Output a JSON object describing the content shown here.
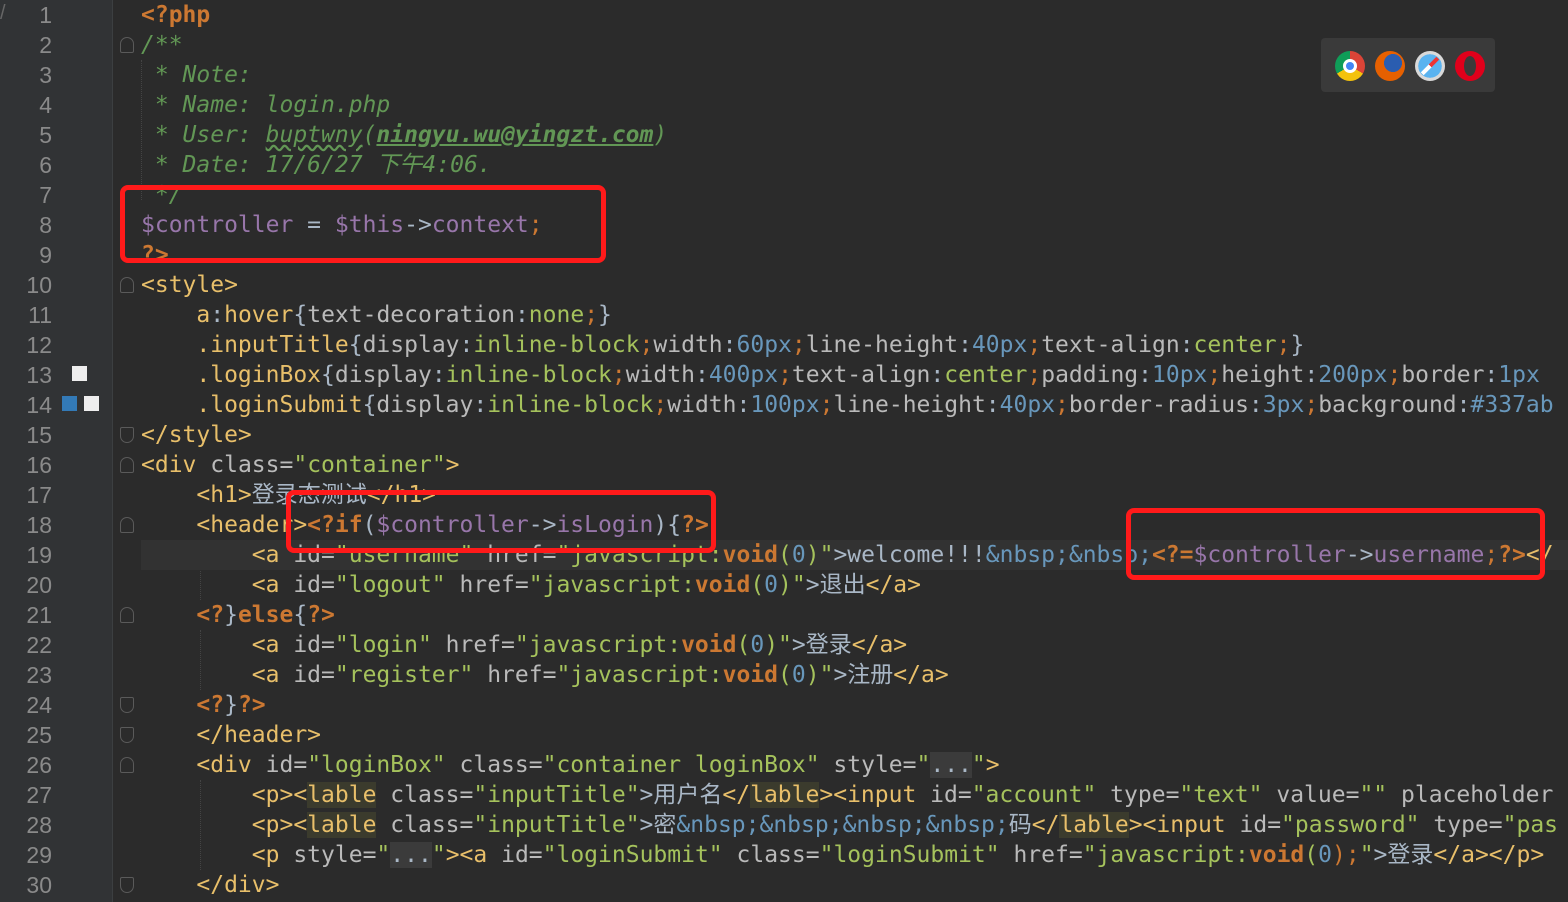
{
  "editor": {
    "line_numbers": [
      "1",
      "2",
      "3",
      "4",
      "5",
      "6",
      "7",
      "8",
      "9",
      "10",
      "11",
      "12",
      "13",
      "14",
      "15",
      "16",
      "17",
      "18",
      "19",
      "20",
      "21",
      "22",
      "23",
      "24",
      "25",
      "26",
      "27",
      "28",
      "29",
      "30"
    ],
    "gutter_top_mark": "/"
  },
  "code": {
    "l1": "<?php",
    "l2": "/**",
    "l3": " * Note:",
    "l4": " * Name: login.php",
    "l5a": " * User: ",
    "l5b": "buptwny",
    "l5c": "(",
    "l5d": "ningyu.wu@yingzt.com",
    "l5e": ")",
    "l6": " * Date: 17/6/27 下午4:06.",
    "l7": " */",
    "l8": [
      "$controller",
      " = ",
      "$this",
      "->",
      "context",
      ";"
    ],
    "l9": "?>",
    "l10": "<style>",
    "l11": [
      "    ",
      "a",
      ":",
      "hover",
      "{",
      "text-decoration",
      ":",
      "none",
      ";",
      "}"
    ],
    "l12": [
      "    ",
      ".inputTitle",
      "{",
      "display",
      ":",
      "inline-block",
      ";",
      "width",
      ":",
      "60px",
      ";",
      "line-height",
      ":",
      "40px",
      ";",
      "text-align",
      ":",
      "center",
      ";",
      "}"
    ],
    "l13": [
      "    ",
      ".loginBox",
      "{",
      "display",
      ":",
      "inline-block",
      ";",
      "width",
      ":",
      "400px",
      ";",
      "text-align",
      ":",
      "center",
      ";",
      "padding",
      ":",
      "10px",
      ";",
      "height",
      ":",
      "200px",
      ";",
      "border",
      ":",
      "1px"
    ],
    "l14": [
      "    ",
      ".loginSubmit",
      "{",
      "display",
      ":",
      "inline-block",
      ";",
      "width",
      ":",
      "100px",
      ";",
      "line-height",
      ":",
      "40px",
      ";",
      "border-radius",
      ":",
      "3px",
      ";",
      "background",
      ":",
      "#337ab"
    ],
    "l15": "</style>",
    "l16": [
      "<div ",
      "class=",
      "\"container\"",
      ">"
    ],
    "l17": [
      "    ",
      "<h1>",
      "登录态测试",
      "</h1>"
    ],
    "l18": [
      "    ",
      "<header>",
      "<?if",
      "(",
      "$controller",
      "->",
      "isLogin",
      "){",
      "?>"
    ],
    "l19": [
      "        ",
      "<a ",
      "id=",
      "\"username\"",
      " href=",
      "\"javascript:",
      "void",
      "(",
      "0",
      ")\"",
      ">welcome!!!",
      "&nbsp;",
      "&nbsp;",
      "<?=",
      "$controller",
      "->",
      "username",
      ";",
      "?>",
      "</"
    ],
    "l20": [
      "        ",
      "<a ",
      "id=",
      "\"logout\"",
      " href=",
      "\"javascript:",
      "void",
      "(",
      "0",
      ")\"",
      ">退出",
      "</a>"
    ],
    "l21": [
      "    ",
      "<?",
      "}",
      "else",
      "{",
      "?>"
    ],
    "l22": [
      "        ",
      "<a ",
      "id=",
      "\"login\"",
      " href=",
      "\"javascript:",
      "void",
      "(",
      "0",
      ")\"",
      ">登录",
      "</a>"
    ],
    "l23": [
      "        ",
      "<a ",
      "id=",
      "\"register\"",
      " href=",
      "\"javascript:",
      "void",
      "(",
      "0",
      ")\"",
      ">注册",
      "</a>"
    ],
    "l24": [
      "    ",
      "<?",
      "}",
      "?>"
    ],
    "l25": [
      "    ",
      "</header>"
    ],
    "l26": [
      "    ",
      "<div ",
      "id=",
      "\"loginBox\"",
      " class=",
      "\"container loginBox\"",
      " style=",
      "\"",
      "...",
      "\"",
      ">"
    ],
    "l27": [
      "        ",
      "<p>",
      "<",
      "lable",
      " class=",
      "\"inputTitle\"",
      ">用户名",
      "</",
      "lable",
      ">",
      "<input ",
      "id=",
      "\"account\"",
      " type=",
      "\"text\"",
      " value=",
      "\"\"",
      " placeholder"
    ],
    "l28": [
      "        ",
      "<p>",
      "<",
      "lable",
      " class=",
      "\"inputTitle\"",
      ">密",
      "&nbsp;&nbsp;&nbsp;&nbsp;",
      "码",
      "</",
      "lable",
      ">",
      "<input ",
      "id=",
      "\"password\"",
      " type=",
      "\"pas"
    ],
    "l29": [
      "        ",
      "<p ",
      "style=",
      "\"",
      "...",
      "\"",
      ">",
      "<a ",
      "id=",
      "\"loginSubmit\"",
      " class=",
      "\"loginSubmit\"",
      " href=",
      "\"javascript:",
      "void",
      "(",
      "0",
      ");",
      "\"",
      ">登录",
      "</a>",
      "</p>"
    ],
    "l30": [
      "    ",
      "</div>"
    ]
  },
  "browser_icons": [
    "chrome-icon",
    "firefox-icon",
    "safari-icon",
    "opera-icon"
  ],
  "colors": {
    "background": "#2b2b2b",
    "keyword": "#cc7832",
    "variable": "#9876aa",
    "string": "#a5c25c",
    "comment": "#629755",
    "annotation": "#ff1a1a"
  }
}
